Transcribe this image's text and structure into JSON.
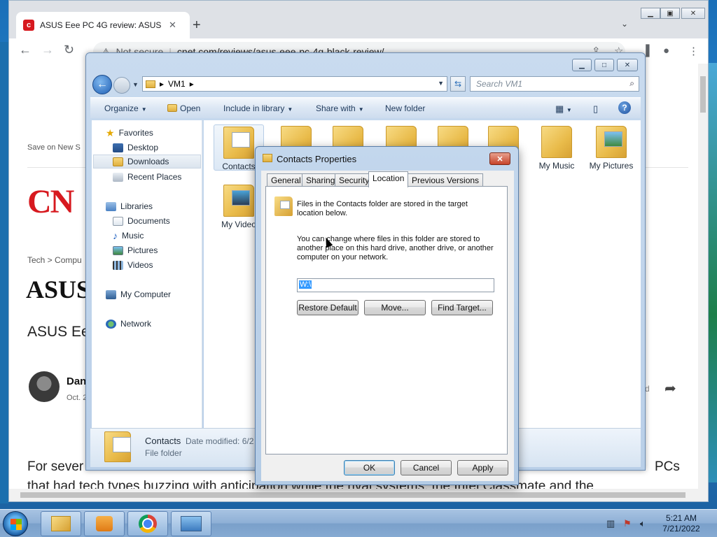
{
  "browser": {
    "tab_title": "ASUS Eee PC 4G review: ASUS Ee",
    "tab_close": "✕",
    "new_tab": "+",
    "security": "Not secure",
    "url": "cnet.com/reviews/asus-eee-pc-4g-black-review/"
  },
  "article": {
    "save_on": "Save on New S",
    "logo_text": "CN",
    "breadcrumb": "Tech  >  Compu",
    "headline": "ASUS",
    "subhead": "ASUS Ee",
    "author_name": "Dan",
    "author_date": "Oct. 2",
    "right_fragment": "d",
    "body_line1": "For sever",
    "body_pcs": "PCs",
    "body_line2": "that had tech types buzzing with anticipation while the rival systems, the Intel Classmate and the"
  },
  "explorer": {
    "address_path": "VM1",
    "search_placeholder": "Search VM1",
    "commands": {
      "organize": "Organize",
      "open": "Open",
      "include_in_library": "Include in library",
      "share_with": "Share with",
      "new_folder": "New folder"
    },
    "nav": {
      "favorites": "Favorites",
      "desktop": "Desktop",
      "downloads": "Downloads",
      "recent_places": "Recent Places",
      "libraries": "Libraries",
      "documents": "Documents",
      "music": "Music",
      "pictures": "Pictures",
      "videos": "Videos",
      "my_computer": "My Computer",
      "network": "Network"
    },
    "files": {
      "contacts": "Contacts",
      "my_music": "My Music",
      "my_pictures": "My Pictures",
      "my_videos": "My Video",
      "hidden_fragment": "ts"
    },
    "status": {
      "name": "Contacts",
      "date_modified": "Date modified: 6/2",
      "type": "File folder"
    }
  },
  "dialog": {
    "title": "Contacts Properties",
    "tabs": {
      "general": "General",
      "sharing": "Sharing",
      "security": "Security",
      "location": "Location",
      "previous_versions": "Previous Versions"
    },
    "para1_line1": "Files in the Contacts folder are stored in the target",
    "para1_line2": "location below.",
    "para2_line1": "You can change where files in this folder are stored to",
    "para2_line2": "another place on this hard drive, another drive, or another",
    "para2_line3": "computer on your network.",
    "path_value": "W:\\",
    "restore_default": "Restore Default",
    "move": "Move...",
    "find_target": "Find Target...",
    "ok": "OK",
    "cancel": "Cancel",
    "apply": "Apply"
  },
  "taskbar": {
    "time": "5:21 AM",
    "date": "7/21/2022"
  }
}
